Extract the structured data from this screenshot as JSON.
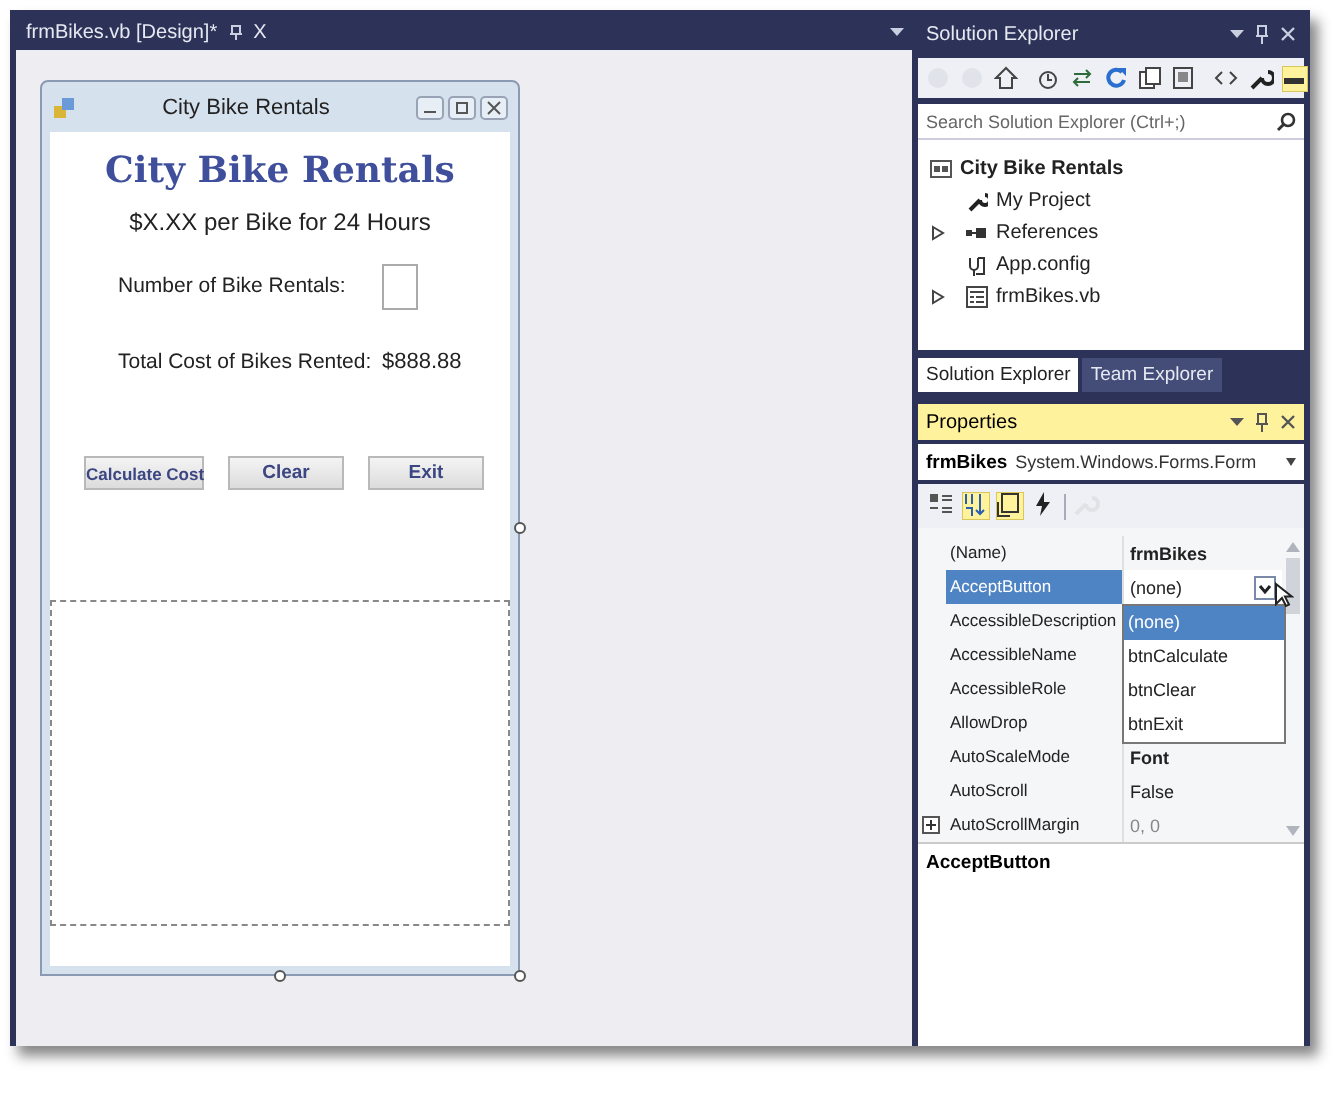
{
  "document_tab": {
    "label": "frmBikes.vb [Design]*",
    "close": "X"
  },
  "form": {
    "title": "City Bike Rentals",
    "heading": "City Bike Rentals",
    "rate_text": "$X.XX per Bike for 24 Hours",
    "quantity_label": "Number of Bike Rentals:",
    "total_label": "Total Cost of Bikes Rented:",
    "total_value": "$888.88",
    "buttons": [
      {
        "label": "Calculate Cost"
      },
      {
        "label": "Clear"
      },
      {
        "label": "Exit"
      }
    ]
  },
  "solution_explorer": {
    "title": "Solution Explorer",
    "toolbar": [
      {
        "kind": "back",
        "disabled": true,
        "selected": false
      },
      {
        "kind": "forward",
        "disabled": true,
        "selected": false
      },
      {
        "kind": "home",
        "disabled": false,
        "selected": false
      },
      {
        "kind": "sep"
      },
      {
        "kind": "pending",
        "disabled": false,
        "selected": false
      },
      {
        "kind": "sync",
        "disabled": false,
        "selected": false
      },
      {
        "kind": "refresh",
        "disabled": false,
        "selected": false
      },
      {
        "kind": "collapse",
        "disabled": false,
        "selected": false
      },
      {
        "kind": "showall",
        "disabled": false,
        "selected": false
      },
      {
        "kind": "sep"
      },
      {
        "kind": "code",
        "disabled": false,
        "selected": false
      },
      {
        "kind": "properties",
        "disabled": false,
        "selected": false
      },
      {
        "kind": "preview",
        "disabled": false,
        "selected": true
      }
    ],
    "search": {
      "placeholder": "Search Solution Explorer (Ctrl+;)"
    },
    "tree": [
      {
        "label": "City Bike Rentals",
        "kind": "solution",
        "children": [
          {
            "label": "My Project",
            "kind": "wrench"
          },
          {
            "label": "References",
            "kind": "references",
            "expanded": false
          },
          {
            "label": "App.config",
            "kind": "config"
          },
          {
            "label": "frmBikes.vb",
            "kind": "form",
            "expanded": false
          }
        ]
      }
    ]
  },
  "panel_tabs": [
    {
      "label": "Solution Explorer",
      "selected": true
    },
    {
      "label": "Team Explorer",
      "selected": false
    }
  ],
  "properties": {
    "title": "Properties",
    "object_name": "frmBikes",
    "object_type": "System.Windows.Forms.Form",
    "toolbar": [
      {
        "kind": "categorized",
        "selected": false,
        "disabled": false
      },
      {
        "kind": "alphabetical",
        "selected": true,
        "disabled": false
      },
      {
        "kind": "properties",
        "selected": true,
        "disabled": false
      },
      {
        "kind": "events",
        "selected": false,
        "disabled": false
      },
      {
        "kind": "sep"
      },
      {
        "kind": "pages",
        "selected": false,
        "disabled": true
      }
    ],
    "rows": [
      {
        "name": "(Name)",
        "value": "frmBikes",
        "bold": true,
        "selected": false
      },
      {
        "name": "AcceptButton",
        "value": "(none)",
        "bold": false,
        "selected": true
      },
      {
        "name": "AccessibleDescription",
        "selected": false
      },
      {
        "name": "AccessibleName",
        "selected": false
      },
      {
        "name": "AccessibleRole",
        "selected": false
      },
      {
        "name": "AllowDrop",
        "selected": false
      },
      {
        "name": "AutoScaleMode",
        "value": "Font",
        "bold": true,
        "selected": false
      },
      {
        "name": "AutoScroll",
        "value": "False",
        "bold": false,
        "selected": false
      },
      {
        "name": "AutoScrollMargin",
        "value": "0, 0",
        "bold": false,
        "selected": false,
        "expanded": false,
        "dim": true
      }
    ],
    "dropdown": [
      {
        "label": "(none)",
        "selected": true
      },
      {
        "label": "btnCalculate",
        "selected": false
      },
      {
        "label": "btnClear",
        "selected": false
      },
      {
        "label": "btnExit",
        "selected": false
      }
    ],
    "description_title": "AcceptButton"
  }
}
